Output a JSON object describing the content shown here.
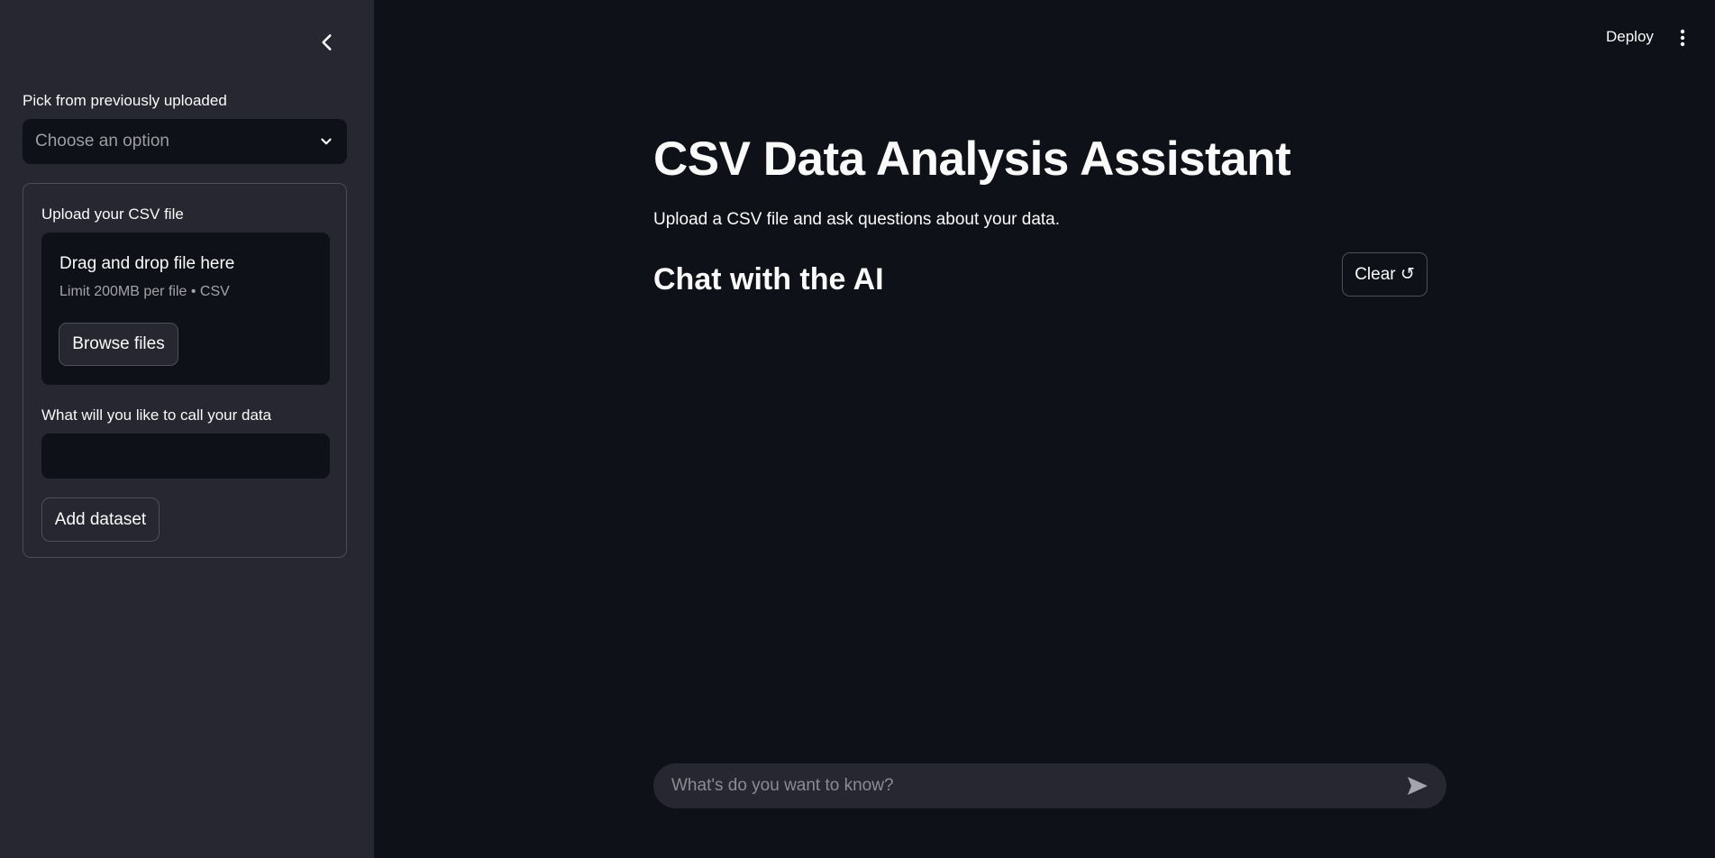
{
  "sidebar": {
    "pick_label": "Pick from previously uploaded",
    "select_placeholder": "Choose an option",
    "form": {
      "upload_label": "Upload your CSV file",
      "drop_title": "Drag and drop file here",
      "drop_limit": "Limit 200MB per file • CSV",
      "browse_label": "Browse files",
      "name_label": "What will you like to call your data",
      "name_value": "",
      "add_label": "Add dataset"
    }
  },
  "header": {
    "deploy_label": "Deploy"
  },
  "main": {
    "title": "CSV Data Analysis Assistant",
    "subtitle": "Upload a CSV file and ask questions about your data.",
    "chat_heading": "Chat with the AI",
    "clear_label": "Clear ↺",
    "chat_placeholder": "What's do you want to know?"
  },
  "colors": {
    "sidebar_bg": "#262730",
    "main_bg": "#0e1117"
  }
}
